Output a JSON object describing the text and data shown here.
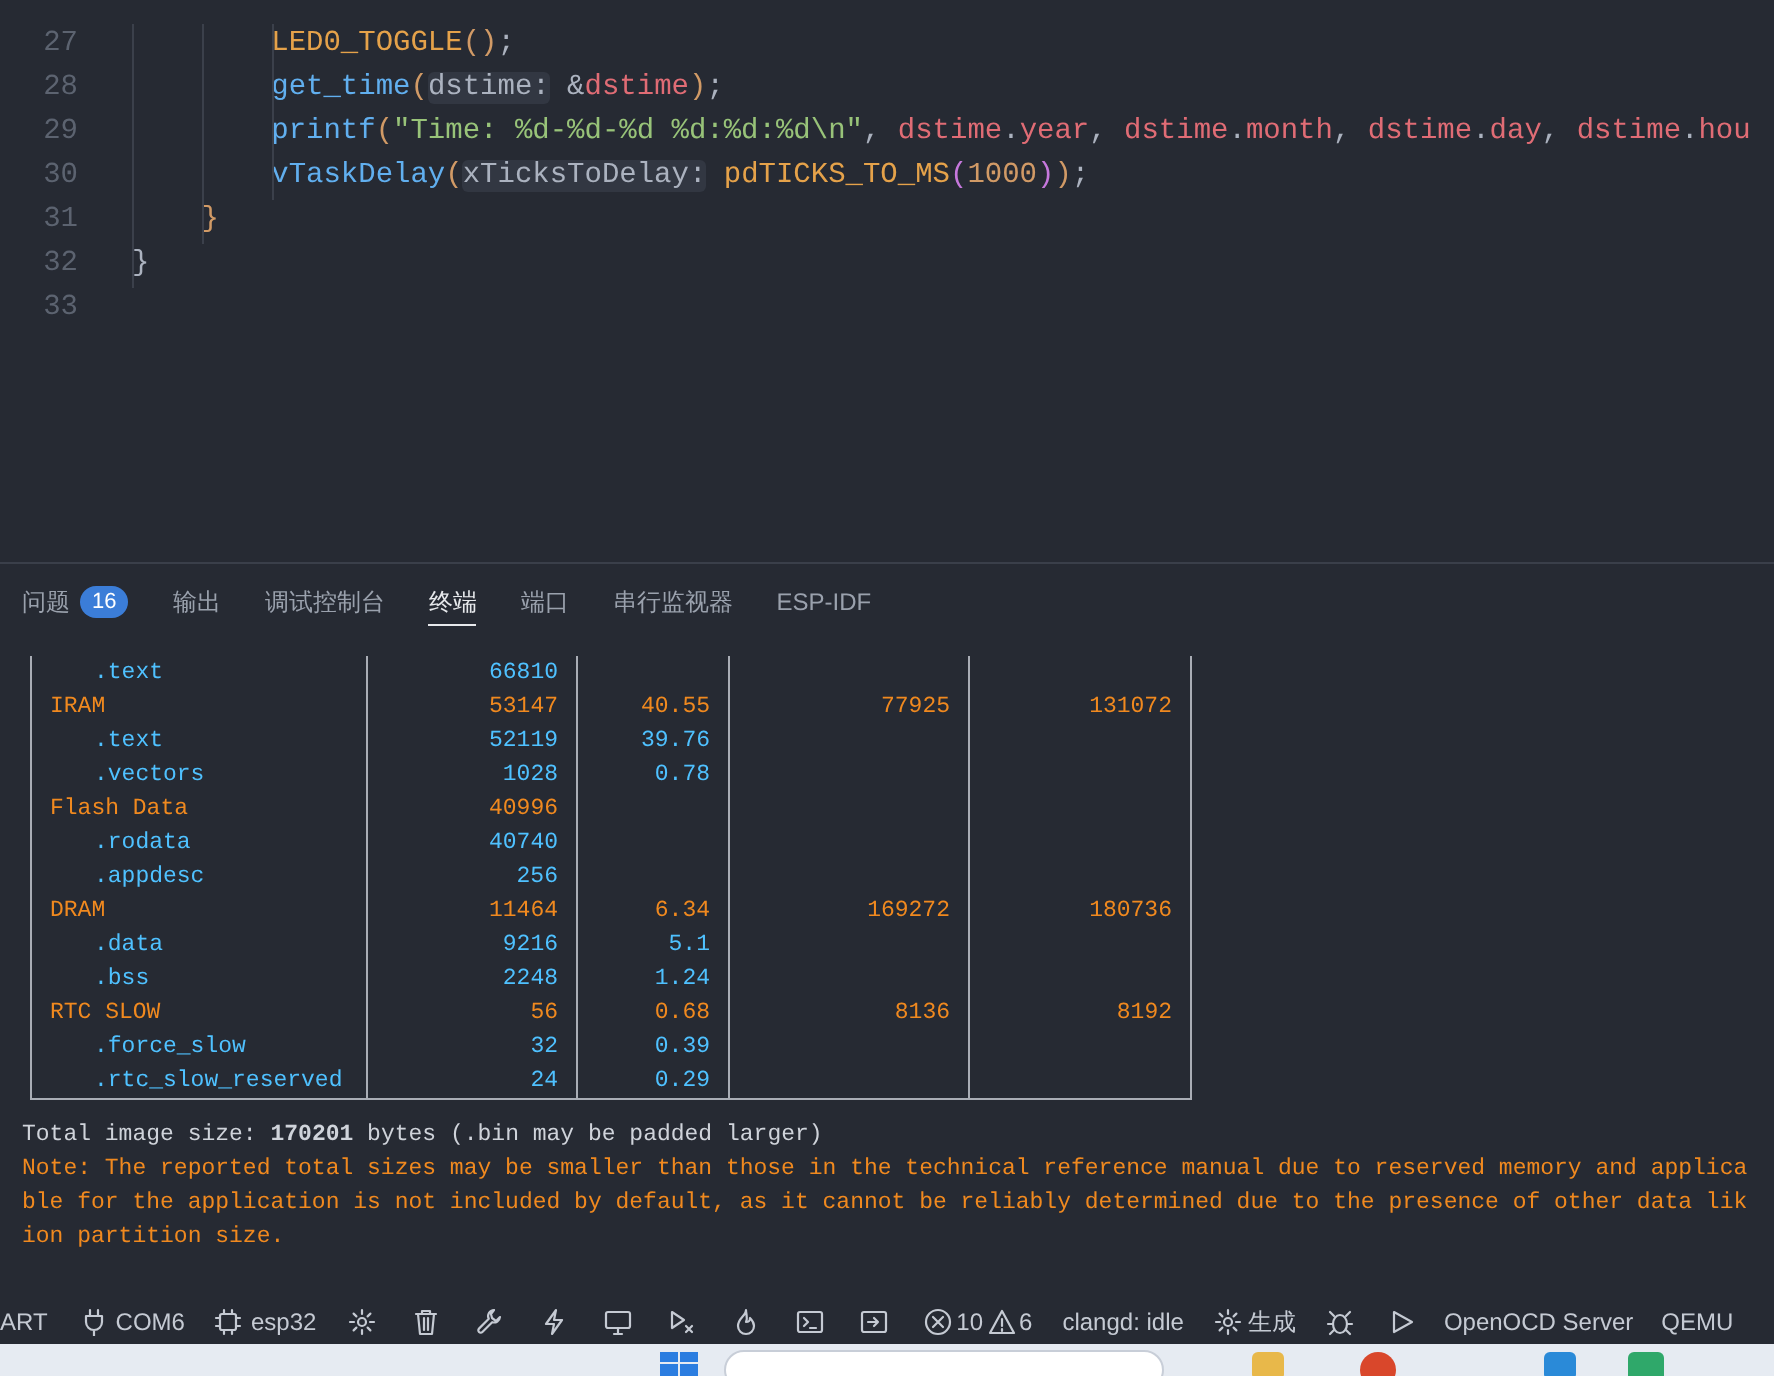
{
  "editor": {
    "lines": [
      {
        "number": "27",
        "tokens": [
          {
            "text": "        LED0_TOGGLE",
            "kind": "macro"
          },
          {
            "text": "()",
            "kind": "brace"
          },
          {
            "text": ";",
            "kind": "plain"
          }
        ]
      },
      {
        "number": "28",
        "tokens": [
          {
            "text": "        get_time",
            "kind": "func"
          },
          {
            "text": "(",
            "kind": "brace"
          },
          {
            "text": "dstime:",
            "kind": "hint"
          },
          {
            "text": " &",
            "kind": "plain"
          },
          {
            "text": "dstime",
            "kind": "var"
          },
          {
            "text": ")",
            "kind": "brace"
          },
          {
            "text": ";",
            "kind": "plain"
          }
        ]
      },
      {
        "number": "29",
        "tokens": [
          {
            "text": "        printf",
            "kind": "func"
          },
          {
            "text": "(",
            "kind": "brace"
          },
          {
            "text": "\"Time: %d-%d-%d %d:%d:%d\\n\"",
            "kind": "string"
          },
          {
            "text": ", ",
            "kind": "plain"
          },
          {
            "text": "dstime",
            "kind": "var"
          },
          {
            "text": ".",
            "kind": "plain"
          },
          {
            "text": "year",
            "kind": "var"
          },
          {
            "text": ", ",
            "kind": "plain"
          },
          {
            "text": "dstime",
            "kind": "var"
          },
          {
            "text": ".",
            "kind": "plain"
          },
          {
            "text": "month",
            "kind": "var"
          },
          {
            "text": ", ",
            "kind": "plain"
          },
          {
            "text": "dstime",
            "kind": "var"
          },
          {
            "text": ".",
            "kind": "plain"
          },
          {
            "text": "day",
            "kind": "var"
          },
          {
            "text": ", ",
            "kind": "plain"
          },
          {
            "text": "dstime",
            "kind": "var"
          },
          {
            "text": ".",
            "kind": "plain"
          },
          {
            "text": "hou",
            "kind": "var"
          }
        ]
      },
      {
        "number": "30",
        "tokens": [
          {
            "text": "        vTaskDelay",
            "kind": "func"
          },
          {
            "text": "(",
            "kind": "brace"
          },
          {
            "text": "xTicksToDelay:",
            "kind": "hint"
          },
          {
            "text": " pdTICKS_TO_MS",
            "kind": "macro"
          },
          {
            "text": "(",
            "kind": "paren2"
          },
          {
            "text": "1000",
            "kind": "number"
          },
          {
            "text": ")",
            "kind": "paren2"
          },
          {
            "text": ")",
            "kind": "brace"
          },
          {
            "text": ";",
            "kind": "plain"
          }
        ]
      },
      {
        "number": "31",
        "tokens": [
          {
            "text": "    }",
            "kind": "brace"
          }
        ]
      },
      {
        "number": "32",
        "tokens": [
          {
            "text": "}",
            "kind": "plain"
          }
        ]
      },
      {
        "number": "33"
      }
    ]
  },
  "panel": {
    "tabs": [
      {
        "label": "问题",
        "badge": "16",
        "selected": false
      },
      {
        "label": "输出",
        "selected": false
      },
      {
        "label": "调试控制台",
        "selected": false
      },
      {
        "label": "终端",
        "selected": true
      },
      {
        "label": "端口",
        "selected": false
      },
      {
        "label": "串行监视器",
        "selected": false
      },
      {
        "label": "ESP-IDF",
        "selected": false
      }
    ]
  },
  "terminal": {
    "table_rows": [
      {
        "kind": "sub",
        "cells": [
          ".text",
          "66810",
          "",
          "",
          ""
        ]
      },
      {
        "kind": "section",
        "cells": [
          "IRAM",
          "53147",
          "40.55",
          "77925",
          "131072"
        ]
      },
      {
        "kind": "sub",
        "cells": [
          ".text",
          "52119",
          "39.76",
          "",
          ""
        ]
      },
      {
        "kind": "sub",
        "cells": [
          ".vectors",
          "1028",
          "0.78",
          "",
          ""
        ]
      },
      {
        "kind": "section",
        "cells": [
          "Flash Data",
          "40996",
          "",
          "",
          ""
        ]
      },
      {
        "kind": "sub",
        "cells": [
          ".rodata",
          "40740",
          "",
          "",
          ""
        ]
      },
      {
        "kind": "sub",
        "cells": [
          ".appdesc",
          "256",
          "",
          "",
          ""
        ]
      },
      {
        "kind": "section",
        "cells": [
          "DRAM",
          "11464",
          "6.34",
          "169272",
          "180736"
        ]
      },
      {
        "kind": "sub",
        "cells": [
          ".data",
          "9216",
          "5.1",
          "",
          ""
        ]
      },
      {
        "kind": "sub",
        "cells": [
          ".bss",
          "2248",
          "1.24",
          "",
          ""
        ]
      },
      {
        "kind": "section",
        "cells": [
          "RTC SLOW",
          "56",
          "0.68",
          "8136",
          "8192"
        ]
      },
      {
        "kind": "sub",
        "cells": [
          ".force_slow",
          "32",
          "0.39",
          "",
          ""
        ]
      },
      {
        "kind": "sub",
        "cells": [
          ".rtc_slow_reserved",
          "24",
          "0.29",
          "",
          ""
        ]
      }
    ],
    "output_lines": [
      {
        "kind": "info",
        "text": "Total image size: **170201** bytes (.bin may be padded larger)"
      },
      {
        "kind": "note",
        "text": "Note: The reported total sizes may be smaller than those in the technical reference manual due to reserved memory and applica"
      },
      {
        "kind": "note",
        "text": "ble for the application is not included by default, as it cannot be reliably determined due to the presence of other data lik"
      },
      {
        "kind": "note",
        "text": "ion partition size."
      }
    ]
  },
  "status_bar": {
    "uart": "ART",
    "port": "COM6",
    "target": "esp32",
    "errors": "10",
    "warnings": "6",
    "clangd": "clangd: idle",
    "build": "生成",
    "openocd": "OpenOCD Server",
    "qemu": "QEMU"
  }
}
